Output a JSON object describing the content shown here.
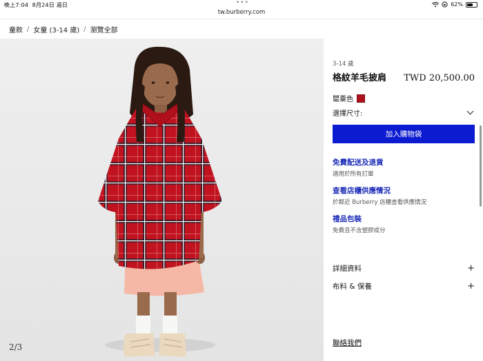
{
  "status_bar": {
    "time": "晚上7:04",
    "date": "8月24日 週日",
    "battery": "62%",
    "battery_level": 0.62,
    "icons": [
      "wifi-icon",
      "rotation-lock-icon",
      "battery-icon"
    ]
  },
  "browser": {
    "url": "tw.burberry.com",
    "tab_dots": "•••"
  },
  "breadcrumb": {
    "items": [
      "童款",
      "女童 (3-14 歲)",
      "瀏覽全部"
    ],
    "separator": "/"
  },
  "gallery": {
    "counter": "2/3",
    "image_subject": "girl-in-red-check-cape"
  },
  "product": {
    "age_range": "3-14 歲",
    "name": "格紋羊毛披肩",
    "price": "TWD 20,500.00",
    "color_label": "罌粟色",
    "color_hex": "#b0121d",
    "size_label": "選擇尺寸:",
    "add_to_bag": "加入購物袋",
    "accent_color": "#0b1bd0"
  },
  "services": [
    {
      "title": "免費配送及退貨",
      "subtitle": "適用於所有訂單"
    },
    {
      "title": "查看店櫃供應情況",
      "subtitle": "於鄰近 Burberry 店櫃查看供應情況"
    },
    {
      "title": "禮品包裝",
      "subtitle": "免費且不含塑膠成分"
    }
  ],
  "accordion": [
    {
      "label": "詳細資料",
      "icon": "+"
    },
    {
      "label": "布料 & 保養",
      "icon": "+"
    }
  ],
  "contact": "聯絡我們"
}
